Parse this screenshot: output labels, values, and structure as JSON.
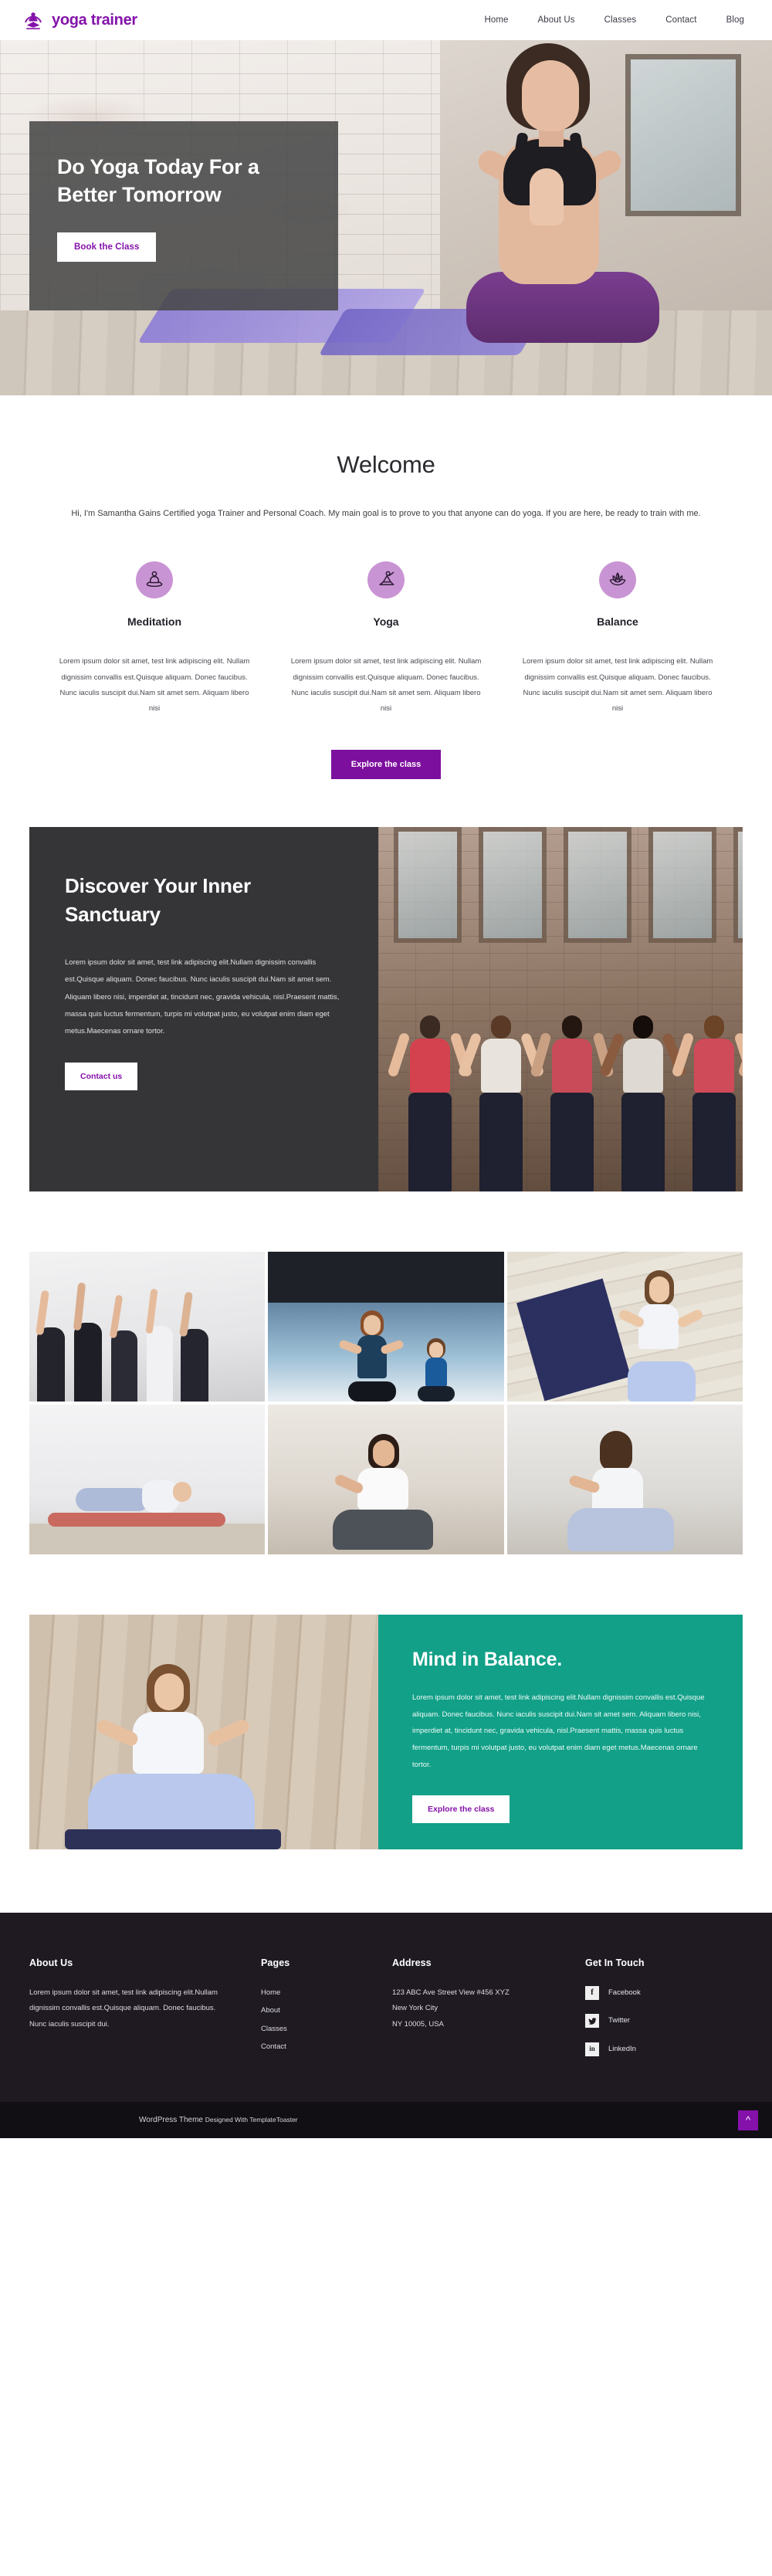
{
  "header": {
    "brand": "yoga trainer",
    "logo_icon": "meditating-person-logo",
    "nav": [
      {
        "label": "Home"
      },
      {
        "label": "About Us"
      },
      {
        "label": "Classes"
      },
      {
        "label": "Contact"
      },
      {
        "label": "Blog"
      }
    ]
  },
  "hero": {
    "title_line1": "Do Yoga Today For a",
    "title_line2": "Better Tomorrow",
    "button": "Book the Class"
  },
  "welcome": {
    "heading": "Welcome",
    "intro": "Hi, I'm Samantha Gains Certified yoga Trainer and Personal Coach. My main goal is to prove to you that anyone can do yoga. If you are here, be ready to train with me.",
    "features": [
      {
        "icon": "meditation-icon",
        "title": "Meditation",
        "text": "Lorem ipsum dolor sit amet, test link adipiscing elit. Nullam dignissim convallis est.Quisque aliquam. Donec faucibus. Nunc iaculis suscipit dui.Nam sit amet sem. Aliquam libero nisi"
      },
      {
        "icon": "yoga-pose-icon",
        "title": "Yoga",
        "text": "Lorem ipsum dolor sit amet, test link adipiscing elit. Nullam dignissim convallis est.Quisque aliquam. Donec faucibus. Nunc iaculis suscipit dui.Nam sit amet sem. Aliquam libero nisi"
      },
      {
        "icon": "lotus-icon",
        "title": "Balance",
        "text": "Lorem ipsum dolor sit amet, test link adipiscing elit. Nullam dignissim convallis est.Quisque aliquam. Donec faucibus. Nunc iaculis suscipit dui.Nam sit amet sem. Aliquam libero nisi"
      }
    ],
    "explore_button": "Explore the class"
  },
  "discover": {
    "title_line1": "Discover  Your Inner",
    "title_line2": "Sanctuary",
    "text": "Lorem ipsum dolor sit amet, test link adipiscing elit.Nullam dignissim convallis est.Quisque aliquam. Donec faucibus. Nunc iaculis suscipit dui.Nam sit amet sem. Aliquam libero nisi, imperdiet at, tincidunt nec, gravida vehicula, nisl.Praesent mattis, massa quis luctus fermentum, turpis mi volutpat justo, eu volutpat enim diam eget metus.Maecenas ornare tortor.",
    "button": "Contact us"
  },
  "gallery": {
    "images": [
      {
        "alt": "group-yoga-class-arms-raised"
      },
      {
        "alt": "mother-and-daughter-meditating"
      },
      {
        "alt": "woman-meditating-on-mat-wooden-stairs"
      },
      {
        "alt": "woman-reclining-stretch-studio"
      },
      {
        "alt": "woman-seated-twist-pose"
      },
      {
        "alt": "woman-seated-forward-bend"
      }
    ]
  },
  "mind": {
    "image_alt": "woman-meditating-lotus-pose-blue-outfit",
    "title": "Mind in Balance.",
    "text": "Lorem ipsum dolor sit amet, test link adipiscing elit.Nullam dignissim convallis est.Quisque aliquam. Donec faucibus. Nunc iaculis suscipit dui.Nam sit amet sem. Aliquam libero nisi, imperdiet at, tincidunt nec, gravida vehicula, nisl.Praesent mattis, massa quis luctus fermentum, turpis mi volutpat justo, eu volutpat enim diam eget metus.Maecenas ornare tortor.",
    "button": "Explore the class"
  },
  "footer": {
    "about": {
      "title": "About Us",
      "text": "Lorem ipsum dolor sit amet, test link adipiscing elit.Nullam dignissim convallis est.Quisque aliquam. Donec faucibus. Nunc iaculis suscipit dui."
    },
    "pages": {
      "title": "Pages",
      "items": [
        {
          "label": "Home"
        },
        {
          "label": "About"
        },
        {
          "label": "Classes"
        },
        {
          "label": "Contact"
        }
      ]
    },
    "address": {
      "title": "Address",
      "line1": "123 ABC Ave Street View #456 XYZ",
      "line2": "New York City",
      "line3": "NY 10005, USA"
    },
    "touch": {
      "title": "Get In Touch",
      "socials": [
        {
          "icon": "facebook-icon",
          "glyph": "f",
          "label": "Facebook"
        },
        {
          "icon": "twitter-icon",
          "glyph": "ᵗ",
          "label": "Twitter"
        },
        {
          "icon": "linkedin-icon",
          "glyph": "in",
          "label": "LinkedIn"
        }
      ]
    },
    "copyright_main": "WordPress Theme",
    "copyright_sub": "Designed With TemplateToaster",
    "to_top_icon": "chevron-up-icon"
  },
  "colors": {
    "brand_purple": "#8412aa",
    "button_purple": "#7d0f9e",
    "icon_circle": "#c994d4",
    "dark_panel": "#353538",
    "teal": "#12a088",
    "footer_bg": "#1f1a22"
  }
}
